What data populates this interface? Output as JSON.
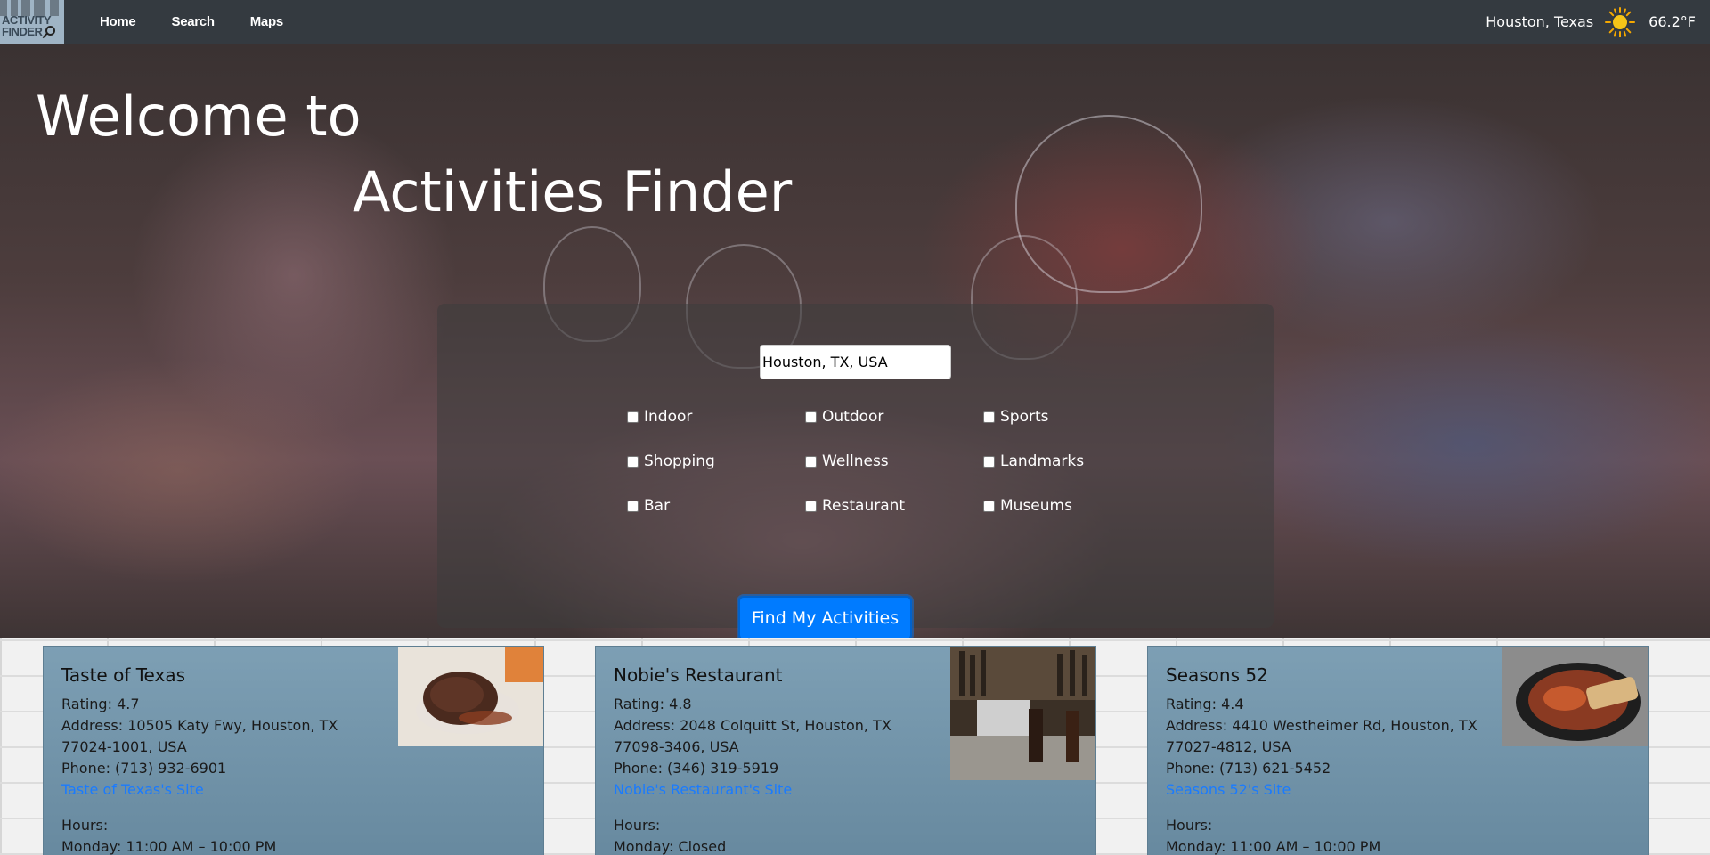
{
  "nav": {
    "logo_line1": "ACTIVITY",
    "logo_line2": "FINDER",
    "links": [
      "Home",
      "Search",
      "Maps"
    ],
    "location": "Houston, Texas",
    "temperature": "66.2°F",
    "weather_icon": "sun-icon"
  },
  "hero": {
    "title_line1": "Welcome to",
    "title_line2": "Activities Finder"
  },
  "search": {
    "location_value": "Houston, TX, USA",
    "categories": [
      "Indoor",
      "Outdoor",
      "Sports",
      "Shopping",
      "Wellness",
      "Landmarks",
      "Bar",
      "Restaurant",
      "Museums"
    ],
    "button_label": "Find My Activities"
  },
  "colors": {
    "navbar": "#343a40",
    "accent": "#007bff",
    "card": "#7d9fb4",
    "link": "#1a7bff"
  },
  "cards": [
    {
      "name": "Taste of Texas",
      "rating": "Rating: 4.7",
      "address": "Address: 10505 Katy Fwy, Houston, TX 77024-1001, USA",
      "phone": "Phone: (713) 932-6901",
      "site_label": "Taste of Texas's Site",
      "hours_label": "Hours:",
      "hours_line": "Monday: 11:00 AM – 10:00 PM"
    },
    {
      "name": "Nobie's Restaurant",
      "rating": "Rating: 4.8",
      "address": "Address: 2048 Colquitt St, Houston, TX 77098-3406, USA",
      "phone": "Phone: (346) 319-5919",
      "site_label": "Nobie's Restaurant's Site",
      "hours_label": "Hours:",
      "hours_line": "Monday: Closed"
    },
    {
      "name": "Seasons 52",
      "rating": "Rating: 4.4",
      "address": "Address: 4410 Westheimer Rd, Houston, TX 77027-4812, USA",
      "phone": "Phone: (713) 621-5452",
      "site_label": "Seasons 52's Site",
      "hours_label": "Hours:",
      "hours_line": "Monday: 11:00 AM – 10:00 PM"
    }
  ]
}
